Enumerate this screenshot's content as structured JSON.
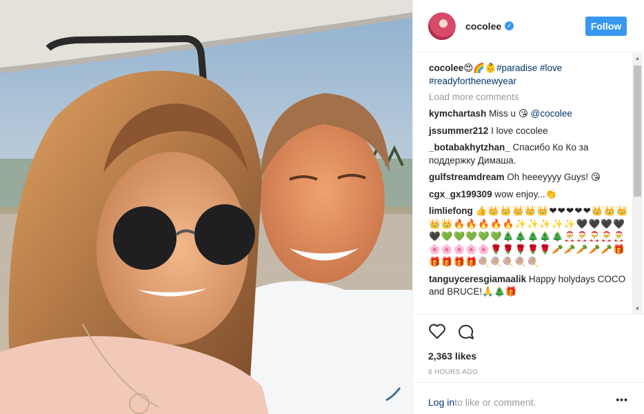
{
  "photo": {
    "alt": "Selfie of a woman in round sunglasses and a man at sunset"
  },
  "header": {
    "username": "cocolee",
    "follow_label": "Follow"
  },
  "caption": {
    "user": "cocolee",
    "emoji": "😍🌈👶",
    "tags": [
      "#paradise",
      "#love",
      "#readyforthenewyear"
    ]
  },
  "load_more": "Load more comments",
  "comments": [
    {
      "user": "kymchartash",
      "text": "Miss u 😘 ",
      "mention": "@cocolee"
    },
    {
      "user": "jssummer212",
      "text": "I love cocolee"
    },
    {
      "user": "_botabakhytzhan_",
      "text": "Спасибо Ко Ко за поддержку Димаша."
    },
    {
      "user": "gulfstreamdream",
      "text": "Oh heeeyyyy Guys! 😘"
    },
    {
      "user": "cgx_gx199309",
      "text": "wow enjoy...👏"
    },
    {
      "user": "limliefong",
      "text": "👍👑👑👑👑👑❤❤❤❤❤👑👑👑👑👑🔥🔥🔥🔥🔥✨✨✨✨✨🖤🖤🖤🖤🖤💚💚💚💚💚🎄🎄🎄🎄🎄🎅🎅🎅🎅🎅🌸🌸🌸🌸🌸🌹🌹🌹🌹🌹🥕🥕🥕🥕🥕🎁🎁🎁🎁🎁🍭🍭🍭🍭🍭"
    },
    {
      "user": "tanguyceresgiamaalik",
      "text": "Happy holydays COCO and BRUCE!🙏🎄🎁"
    }
  ],
  "likes": "2,363 likes",
  "time": "8 HOURS AGO",
  "footer": {
    "login": "Log in",
    "rest": " to like or comment.",
    "more": "•••"
  },
  "icons": {
    "like": "heart-icon",
    "comment": "comment-icon",
    "more": "more-options-icon",
    "verified": "verified-badge-icon"
  },
  "colors": {
    "follow": "#3897f0",
    "link": "#003569"
  }
}
